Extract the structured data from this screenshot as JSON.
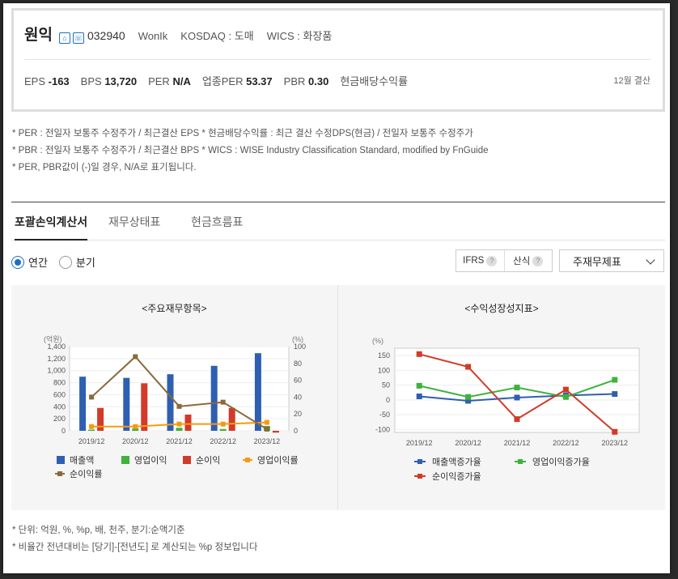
{
  "company": {
    "name": "원익",
    "ticker": "032940",
    "english_name": "WonIk",
    "market": "KOSDAQ : 도매",
    "wics": "WICS : 화장품"
  },
  "metrics": [
    {
      "label": "EPS",
      "value": "-163"
    },
    {
      "label": "BPS",
      "value": "13,720"
    },
    {
      "label": "PER",
      "value": "N/A"
    },
    {
      "label": "업종PER",
      "value": "53.37"
    },
    {
      "label": "PBR",
      "value": "0.30"
    },
    {
      "label": "현금배당수익률",
      "value": ""
    }
  ],
  "fiscal_note": "12월 결산",
  "notes": [
    "* PER : 전일자 보통주 수정주가 / 최근결산 EPS * 현금배당수익률 : 최근 결산 수정DPS(현금) / 전일자 보통주 수정주가",
    "* PBR : 전일자 보통주 수정주가 / 최근결산 BPS * WICS : WISE Industry Classification Standard, modified by FnGuide",
    "* PER, PBR값이 (-)일 경우, N/A로 표기됩니다."
  ],
  "tabs": [
    "포괄손익계산서",
    "재무상태표",
    "현금흐름표"
  ],
  "period_options": {
    "annual": "연간",
    "quarterly": "분기"
  },
  "options": {
    "ifrs": "IFRS",
    "calc": "산식",
    "help": "?"
  },
  "dropdown": {
    "selected": "주재무제표"
  },
  "footer_notes": [
    "* 단위: 억원, %, %p, 배, 천주, 분기:순액기준",
    "* 비율간 전년대비는 [당기]-[전년도] 로 계산되는 %p 정보입니다"
  ],
  "chart_data": [
    {
      "type": "bar",
      "title": "<주요재무항목>",
      "y_unit_left": "(억원)",
      "y_unit_right": "(%)",
      "categories": [
        "2019/12",
        "2020/12",
        "2021/12",
        "2022/12",
        "2023/12"
      ],
      "ylim_left": [
        0,
        1400
      ],
      "yticks_left": [
        "0",
        "200",
        "400",
        "600",
        "800",
        "1,000",
        "1,200",
        "1,400"
      ],
      "ylim_right": [
        0,
        100
      ],
      "yticks_right": [
        "0",
        "20",
        "40",
        "60",
        "80",
        "100"
      ],
      "bar_series": [
        {
          "name": "매출액",
          "color": "#2f5fb0",
          "values": [
            900,
            880,
            940,
            1080,
            1290
          ]
        },
        {
          "name": "영업이익",
          "color": "#3db23d",
          "values": [
            20,
            40,
            50,
            30,
            80
          ]
        },
        {
          "name": "순이익",
          "color": "#d23a2a",
          "values": [
            380,
            790,
            270,
            380,
            -30
          ]
        }
      ],
      "line_series": [
        {
          "name": "영업이익률",
          "color": "#f59a10",
          "values": [
            5,
            5,
            8,
            8,
            10
          ]
        },
        {
          "name": "순이익률",
          "color": "#8a6a3a",
          "values": [
            40,
            88,
            29,
            34,
            2
          ]
        }
      ]
    },
    {
      "type": "line",
      "title": "<수익성장성지표>",
      "y_unit": "(%)",
      "categories": [
        "2019/12",
        "2020/12",
        "2021/12",
        "2022/12",
        "2023/12"
      ],
      "ylim": [
        -110,
        175
      ],
      "yticks": [
        "150",
        "100",
        "50",
        "0",
        "-50",
        "-100"
      ],
      "series": [
        {
          "name": "매출액증가율",
          "color": "#2f5fb0",
          "values": [
            12,
            -3,
            8,
            15,
            20
          ]
        },
        {
          "name": "영업이익증가율",
          "color": "#3db23d",
          "values": [
            48,
            10,
            42,
            10,
            68
          ]
        },
        {
          "name": "순이익증가율",
          "color": "#d23a2a",
          "values": [
            155,
            112,
            -65,
            35,
            -108
          ]
        }
      ]
    }
  ]
}
